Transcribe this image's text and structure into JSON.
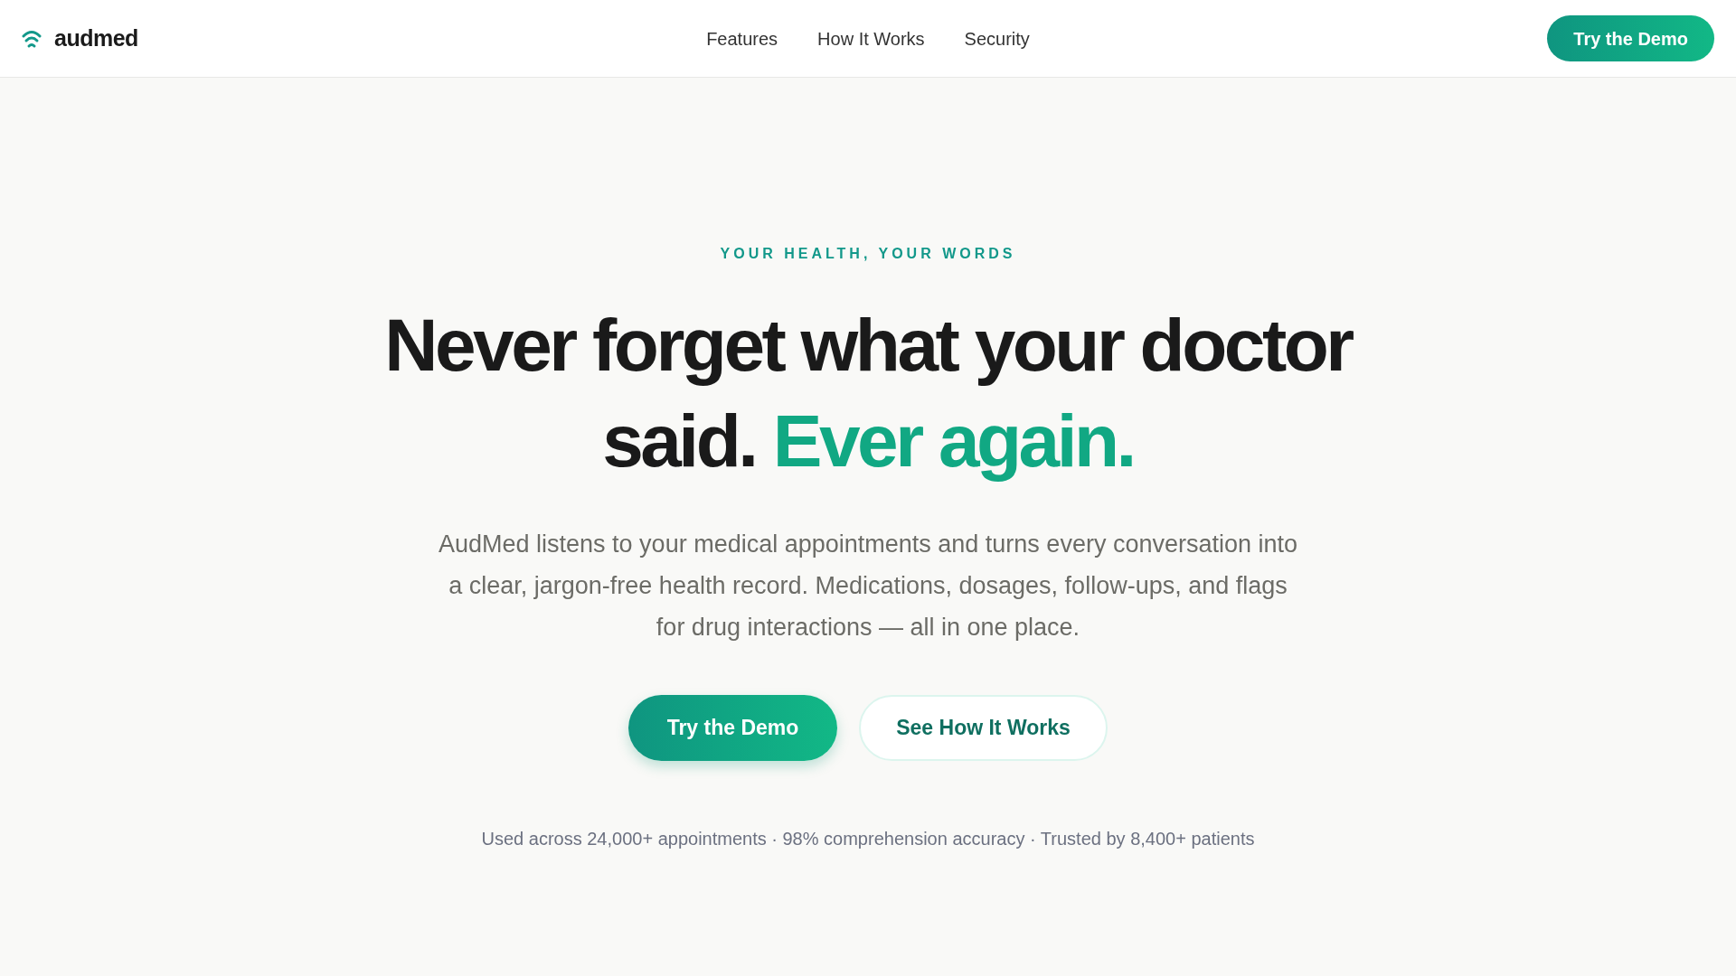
{
  "brand": {
    "name": "audmed"
  },
  "nav": {
    "links": [
      "Features",
      "How It Works",
      "Security"
    ],
    "cta": "Try the Demo"
  },
  "hero": {
    "eyebrow": "YOUR HEALTH, YOUR WORDS",
    "headline": [
      {
        "text": "Never forget what your doctor said. ",
        "accent": false
      },
      {
        "text": "Ever again.",
        "accent": true
      }
    ],
    "description": "AudMed listens to your medical appointments and turns every conversation into a clear, jargon-free health record. Medications, dosages, follow-ups, and flags for drug interactions — all in one place.",
    "buttons": [
      {
        "label": "Try the Demo",
        "kind": "primary"
      },
      {
        "label": "See How It Works",
        "kind": "secondary"
      }
    ],
    "stats": "Used across 24,000+ appointments · 98% comprehension accuracy · Trusted by 8,400+ patients"
  }
}
